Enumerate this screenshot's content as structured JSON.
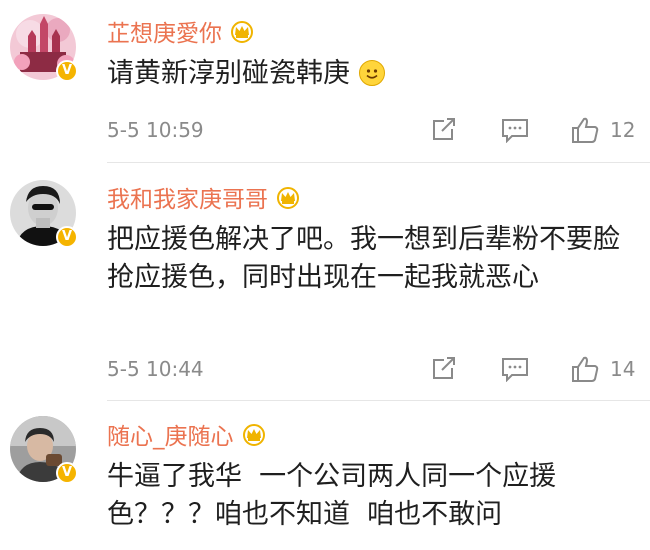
{
  "comments": [
    {
      "username": "芷想庚愛你",
      "text": "请黄新淳别碰瓷韩庚",
      "time": "5-5 10:59",
      "likes": "12",
      "emoji": "smiley-emoji"
    },
    {
      "username": "我和我家庚哥哥",
      "text": "把应援色解决了吧。我一想到后辈粉不要脸抢应援色，同时出现在一起我就恶心",
      "time": "5-5 10:44",
      "likes": "14"
    },
    {
      "username": "随心_庚随心",
      "text": "牛逼了我华  一个公司两人同一个应援色？？？咱也不知道  咱也不敢问"
    }
  ],
  "colors": {
    "username": "#eb7350",
    "meta": "#8a8a8a",
    "badge": "#f5b400"
  },
  "icons": {
    "verified": "V",
    "forward": "share-icon",
    "comment": "comment-icon",
    "like": "thumbs-up-icon"
  }
}
